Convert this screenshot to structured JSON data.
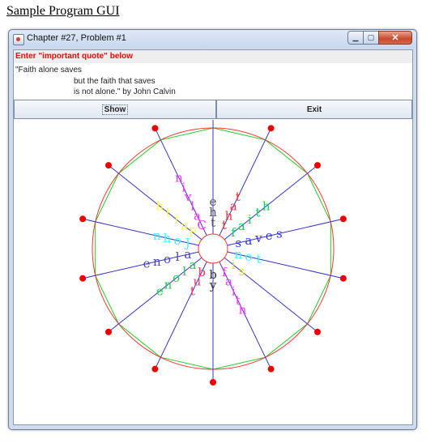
{
  "page": {
    "title": "Sample Program GUI"
  },
  "window": {
    "title": "Chapter #27, Problem #1",
    "icon": "java-app-icon"
  },
  "prompt": {
    "label": "Enter \"important quote\" below"
  },
  "quote": {
    "lines": [
      "\"Faith alone saves",
      "but the faith that saves",
      "is not alone.\" by John Calvin"
    ]
  },
  "buttons": {
    "show": "Show",
    "exit": "Exit"
  },
  "wheel": {
    "spokes": [
      {
        "text": "the",
        "color": "#555555"
      },
      {
        "text": "that",
        "color": "#ff3333"
      },
      {
        "text": "faith",
        "color": "#00dd55"
      },
      {
        "text": "saves",
        "color": "#3333ff"
      },
      {
        "text": "not",
        "color": "#33ffff"
      },
      {
        "text": "is",
        "color": "#dddd33"
      },
      {
        "text": "faith",
        "color": "#ff33ff"
      },
      {
        "text": "by",
        "color": "#333333"
      },
      {
        "text": "but",
        "color": "#ff3366"
      },
      {
        "text": "alone",
        "color": "#22cc55"
      },
      {
        "text": "alone",
        "color": "#4444cc"
      },
      {
        "text": "John",
        "color": "#33ffff"
      },
      {
        "text": "Faith",
        "color": "#ffff33"
      },
      {
        "text": "Calvin",
        "color": "#ff33ff"
      }
    ]
  }
}
